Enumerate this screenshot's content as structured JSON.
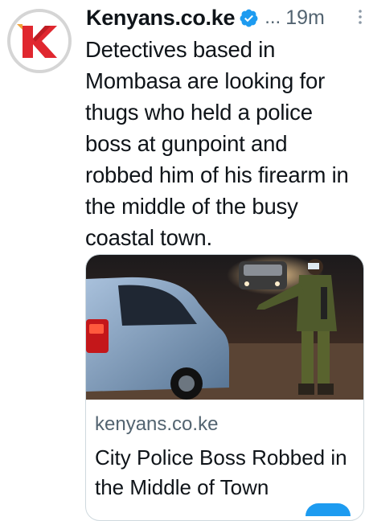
{
  "tweet": {
    "author_name": "Kenyans.co.ke",
    "handle_truncated": "...",
    "time_ago": "19m",
    "avatar_letter": "K",
    "text": "Detectives based in Mombasa are looking for thugs who held a police boss at gunpoint and robbed him of his firearm in the middle of the busy coastal town."
  },
  "card": {
    "domain": "kenyans.co.ke",
    "title": "City Police Boss Robbed in the Middle of Town"
  },
  "colors": {
    "brand_red": "#e0272f",
    "verified_blue": "#1d9bf0",
    "secondary_text": "#536471",
    "border": "#cfd9de"
  },
  "icons": {
    "verified": "verified-badge-icon",
    "more": "more-vertical-icon"
  }
}
